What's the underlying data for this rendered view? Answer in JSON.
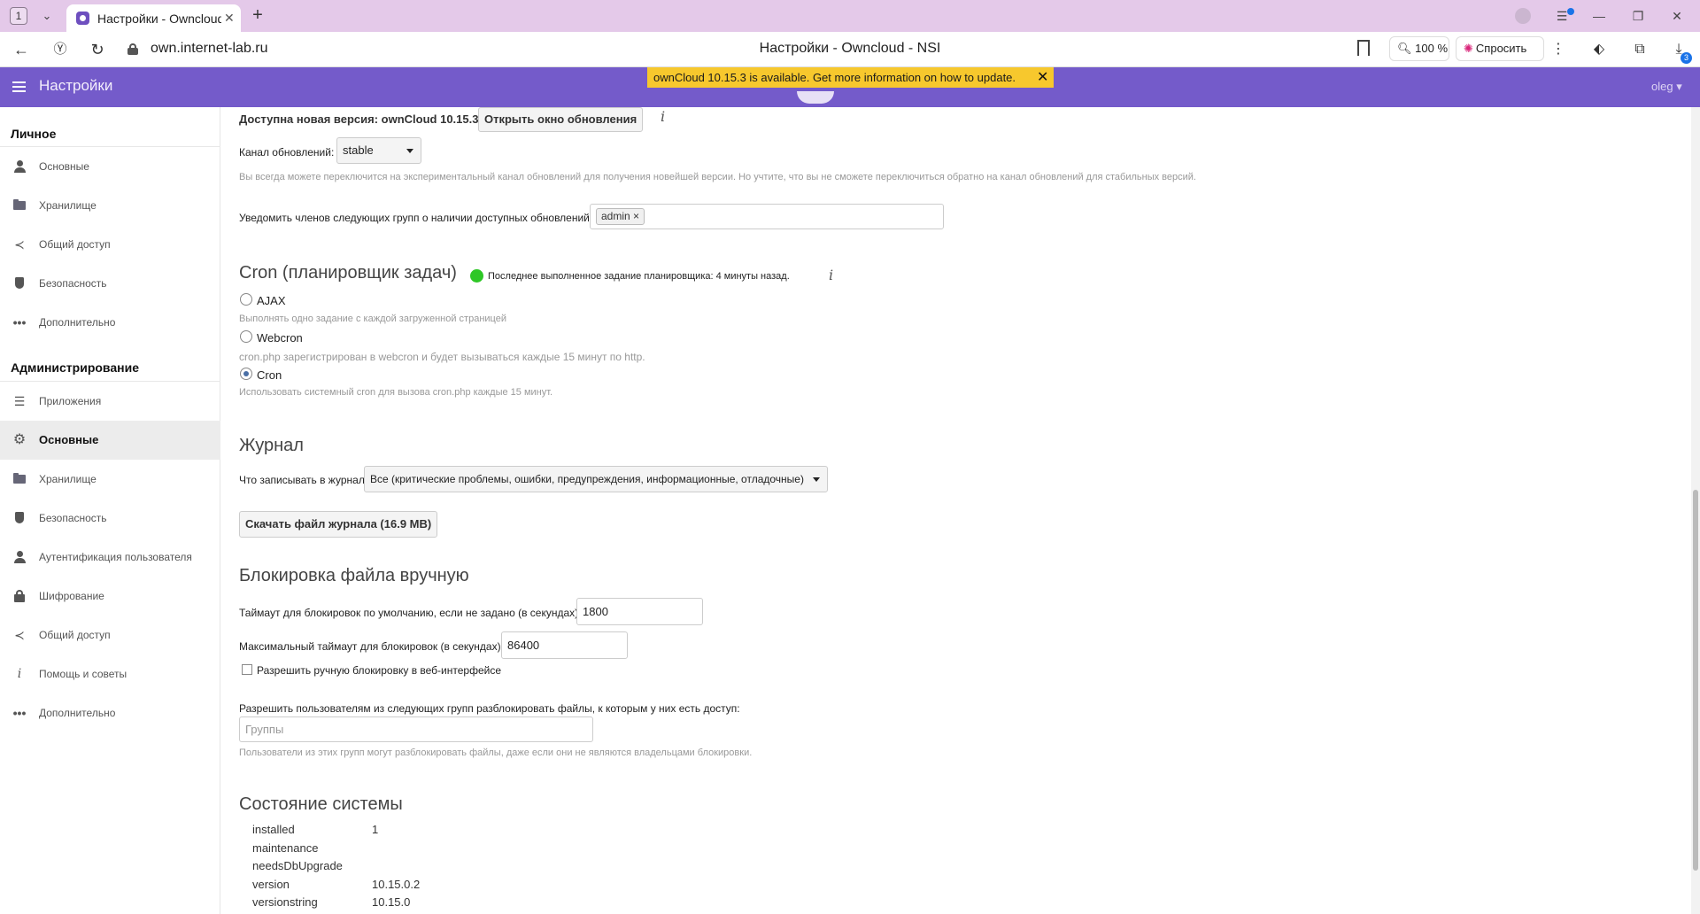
{
  "browser": {
    "tab_count": "1",
    "tab_title": "Настройки - Owncloud - NSI",
    "url": "own.internet-lab.ru",
    "page_title": "Настройки - Owncloud - NSI",
    "zoom": "100 %",
    "ask_label": "Спросить",
    "downloads_badge": "3",
    "accent": "#1a73e8",
    "tabbar_color": "#e4c9e9"
  },
  "header": {
    "app_title": "Настройки",
    "user": "oleg",
    "banner": "ownCloud 10.15.3 is available. Get more information on how to update.",
    "banner_close": "✕",
    "color": "#745bca",
    "banner_color": "#f7c82d"
  },
  "sidebar": {
    "personal_heading": "Личное",
    "admin_heading": "Администрирование",
    "personal_items": [
      {
        "label": "Основные",
        "icon": "user-icon"
      },
      {
        "label": "Хранилище",
        "icon": "folder-icon"
      },
      {
        "label": "Общий доступ",
        "icon": "share-icon"
      },
      {
        "label": "Безопасность",
        "icon": "shield-icon"
      },
      {
        "label": "Дополнительно",
        "icon": "more-icon"
      }
    ],
    "admin_items": [
      {
        "label": "Приложения",
        "icon": "list-icon"
      },
      {
        "label": "Основные",
        "icon": "gear-icon",
        "active": true
      },
      {
        "label": "Хранилище",
        "icon": "folder-icon"
      },
      {
        "label": "Безопасность",
        "icon": "shield-icon"
      },
      {
        "label": "Аутентификация пользователя",
        "icon": "user-icon"
      },
      {
        "label": "Шифрование",
        "icon": "lock-icon"
      },
      {
        "label": "Общий доступ",
        "icon": "share-icon"
      },
      {
        "label": "Помощь и советы",
        "icon": "info-icon"
      },
      {
        "label": "Дополнительно",
        "icon": "more-icon"
      }
    ]
  },
  "updater": {
    "new_version_text": "Доступна новая версия: ownCloud 10.15.3",
    "open_updater_button": "Открыть окно обновления",
    "channel_label": "Канал обновлений:",
    "channel_value": "stable",
    "channel_hint": "Вы всегда можете переключится на экспериментальный канал обновлений для получения новейшей версии. Но учтите, что вы не сможете переключиться обратно на канал обновлений для стабильных версий.",
    "notify_label": "Уведомить членов следующих групп о наличии доступных обновлений:",
    "notify_tag": "admin",
    "tag_remove": "×"
  },
  "cron": {
    "title": "Cron (планировщик задач)",
    "status": "Последнее выполненное задание планировщика: 4 минуты назад.",
    "options": [
      {
        "label": "AJAX",
        "hint": "Выполнять одно задание с каждой загруженной страницей",
        "checked": false
      },
      {
        "label": "Webcron",
        "hint": "cron.php зарегистрирован в webcron и будет вызываться каждые 15 минут по http.",
        "checked": false
      },
      {
        "label": "Cron",
        "hint": "Использовать системный cron для вызова cron.php каждые 15 минут.",
        "checked": true
      }
    ],
    "status_color": "#2ec726"
  },
  "log": {
    "title": "Журнал",
    "level_label": "Что записывать в журнал",
    "level_value": "Все (критические проблемы, ошибки, предупреждения, информационные, отладочные)",
    "download_button": "Скачать файл журнала (16.9 MB)"
  },
  "locking": {
    "title": "Блокировка файла вручную",
    "default_timeout_label": "Таймаут для блокировок по умолчанию, если не задано (в секундах)",
    "default_timeout_value": "1800",
    "max_timeout_label": "Максимальный таймаут для блокировок (в секундах)",
    "max_timeout_value": "86400",
    "allow_web_label": "Разрешить ручную блокировку в веб-интерфейсе",
    "unlock_groups_label": "Разрешить пользователям из следующих групп разблокировать файлы, к которым у них есть доступ:",
    "groups_placeholder": "Группы",
    "unlock_hint": "Пользователи из этих групп могут разблокировать файлы, даже если они не являются владельцами блокировки."
  },
  "status": {
    "title": "Состояние системы",
    "rows": [
      {
        "key": "installed",
        "value": "1"
      },
      {
        "key": "maintenance",
        "value": ""
      },
      {
        "key": "needsDbUpgrade",
        "value": ""
      },
      {
        "key": "version",
        "value": "10.15.0.2"
      },
      {
        "key": "versionstring",
        "value": "10.15.0"
      }
    ]
  }
}
